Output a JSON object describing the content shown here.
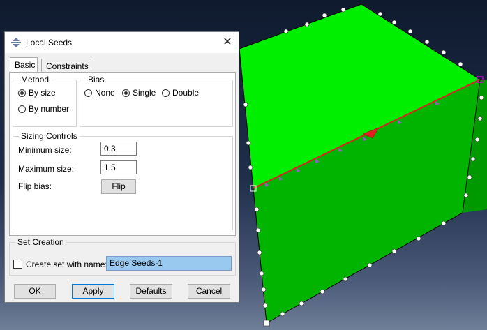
{
  "dialog": {
    "title": "Local Seeds",
    "close": "✕",
    "tabs": [
      {
        "label": "Basic",
        "active": true
      },
      {
        "label": "Constraints",
        "active": false
      }
    ],
    "method": {
      "legend": "Method",
      "options": [
        {
          "label": "By size",
          "selected": true
        },
        {
          "label": "By number",
          "selected": false
        }
      ]
    },
    "bias": {
      "legend": "Bias",
      "options": [
        {
          "label": "None",
          "selected": false
        },
        {
          "label": "Single",
          "selected": true
        },
        {
          "label": "Double",
          "selected": false
        }
      ]
    },
    "sizing": {
      "legend": "Sizing Controls",
      "min_label": "Minimum size:",
      "min_value": "0.3",
      "max_label": "Maximum size:",
      "max_value": "1.5",
      "flip_label": "Flip bias:",
      "flip_button": "Flip"
    },
    "set_creation": {
      "legend": "Set Creation",
      "checkbox_label": "Create set with name:",
      "checked": false,
      "name_value": "Edge Seeds-1"
    },
    "buttons": {
      "ok": "OK",
      "apply": "Apply",
      "defaults": "Defaults",
      "cancel": "Cancel"
    }
  },
  "viewport": {
    "cube_top_color": "#00ee00",
    "cube_front_color": "#00b000",
    "cube_right_color": "#009000",
    "edge_color": "#e02020",
    "selected_vertex_color": "#cc00cc",
    "seed_marker_color": "#9060c0"
  }
}
